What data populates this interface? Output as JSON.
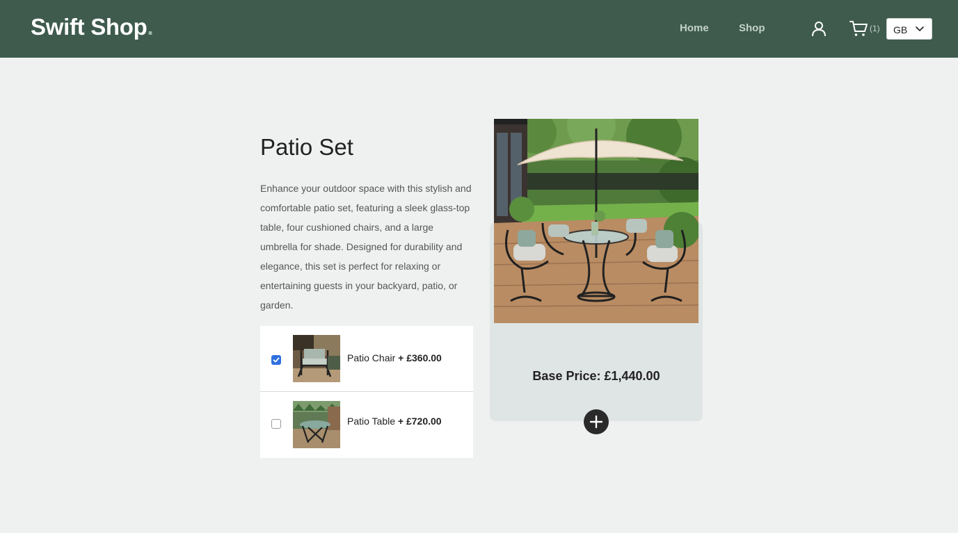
{
  "header": {
    "brand": "Swift Shop",
    "brand_dot": ".",
    "nav": {
      "home": "Home",
      "shop": "Shop"
    },
    "icons": {
      "account": "user-icon",
      "cart": "cart-icon"
    },
    "cart_count": "(1)",
    "region": "GB"
  },
  "product": {
    "title": "Patio Set",
    "description": "Enhance your outdoor space with this stylish and comfortable patio set, featuring a sleek glass-top table, four cushioned chairs, and a large umbrella for shade. Designed for durability and elegance, this set is perfect for relaxing or entertaining guests in your backyard, patio, or garden.",
    "base_price_label": "Base Price:",
    "base_price": "£1,440.00",
    "options": [
      {
        "name": "Patio Chair",
        "price": "+ £360.00",
        "checked": true
      },
      {
        "name": "Patio Table",
        "price": "+ £720.00",
        "checked": false
      }
    ]
  },
  "colors": {
    "header_bg": "#3e5b4e",
    "page_bg": "#eff1f0",
    "card_bg": "#dfe5e4",
    "checkbox_accent": "#2f6fdf",
    "add_button": "#2a2a2a"
  }
}
